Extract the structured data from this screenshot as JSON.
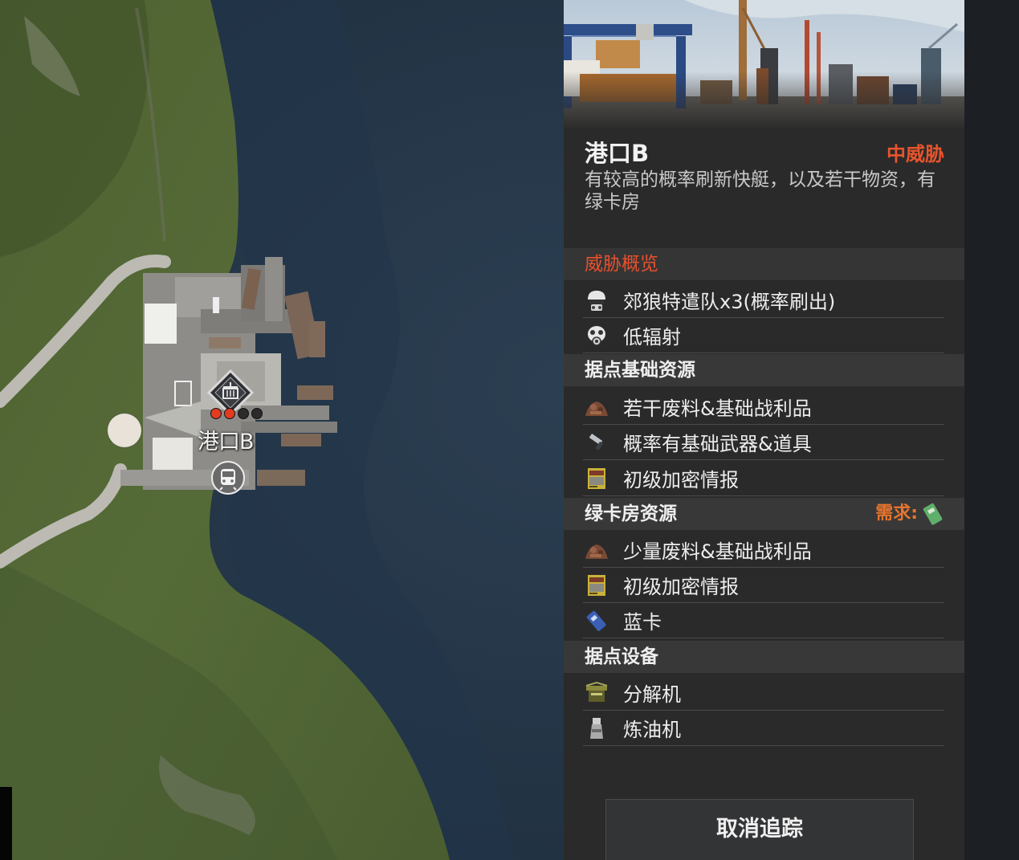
{
  "map": {
    "location_label": "港口B",
    "threat_dot_colors": [
      "#e33b20",
      "#e33b20",
      "#2b2b2b",
      "#2b2b2b"
    ]
  },
  "panel": {
    "title": "港口B",
    "threat_level": "中威胁",
    "description": "有较高的概率刷新快艇，以及若干物资，有绿卡房",
    "sections": {
      "threat_overview": {
        "label": "威胁概览",
        "items": [
          {
            "icon": "soldier-helmet-icon",
            "text": "郊狼特遣队x3(概率刷出)"
          },
          {
            "icon": "gas-mask-icon",
            "text": "低辐射"
          }
        ]
      },
      "base_resources": {
        "label": "据点基础资源",
        "items": [
          {
            "icon": "scrap-pile-icon",
            "text": "若干废料&基础战利品"
          },
          {
            "icon": "pistol-icon",
            "text": "概率有基础武器&道具"
          },
          {
            "icon": "intel-booklet-icon",
            "text": "初级加密情报"
          }
        ]
      },
      "greencard_resources": {
        "label": "绿卡房资源",
        "requirement_label": "需求:",
        "requirement_icon": "green-keycard-icon",
        "items": [
          {
            "icon": "scrap-pile-icon",
            "text": "少量废料&基础战利品"
          },
          {
            "icon": "intel-booklet-icon",
            "text": "初级加密情报"
          },
          {
            "icon": "blue-keycard-icon",
            "text": "蓝卡"
          }
        ]
      },
      "equipment": {
        "label": "据点设备",
        "items": [
          {
            "icon": "disassembler-icon",
            "text": "分解机"
          },
          {
            "icon": "oil-refiner-icon",
            "text": "炼油机"
          }
        ]
      }
    },
    "cancel_button": "取消追踪"
  }
}
